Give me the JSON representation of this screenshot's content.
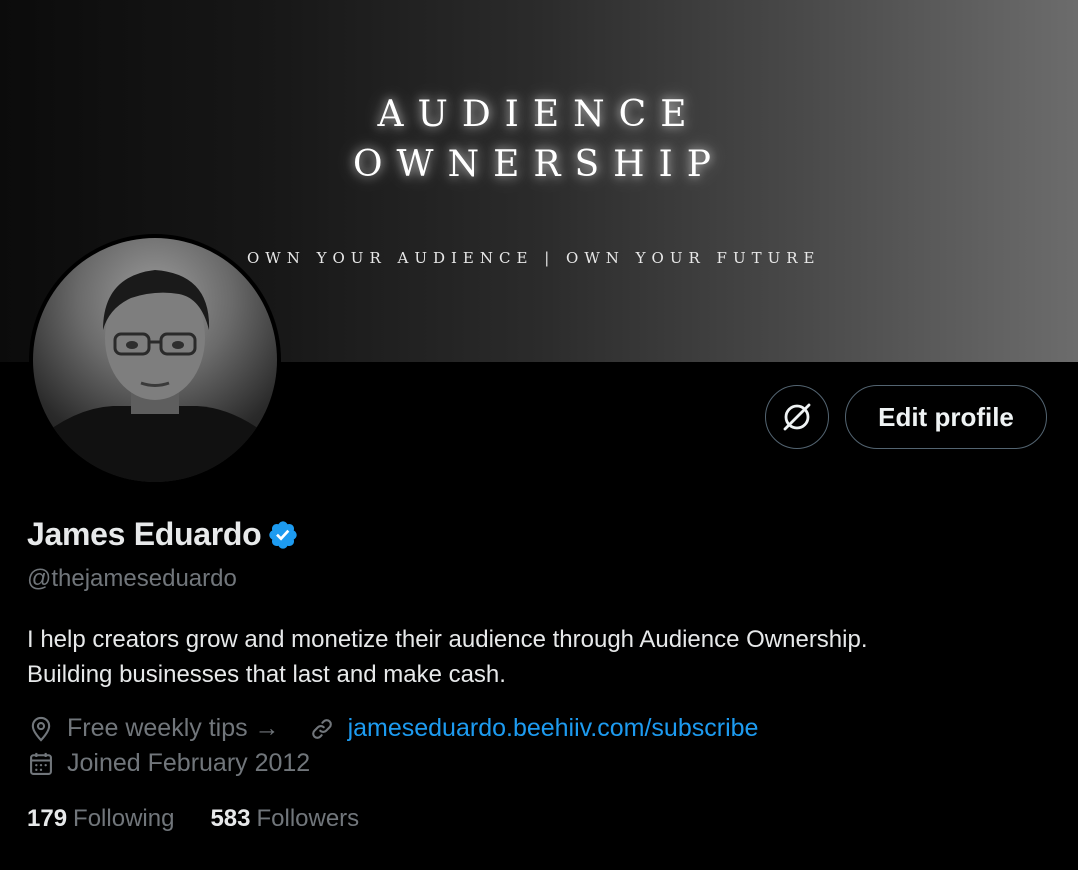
{
  "banner": {
    "title_line1": "AUDIENCE",
    "title_line2": "OWNERSHIP",
    "tagline": "OWN YOUR AUDIENCE | OWN YOUR FUTURE"
  },
  "actions": {
    "edit_profile_label": "Edit profile",
    "icon_button": "grok-icon"
  },
  "profile": {
    "name": "James Eduardo",
    "verified": true,
    "handle": "@thejameseduardo",
    "bio_line1": "I help creators grow and monetize their audience through Audience Ownership.",
    "bio_line2": "Building businesses that last and make cash.",
    "location": "Free weekly tips →",
    "website": "jameseduardo.beehiiv.com/subscribe",
    "joined": "Joined February 2012"
  },
  "stats": {
    "following_count": "179",
    "following_label": "Following",
    "followers_count": "583",
    "followers_label": "Followers"
  },
  "colors": {
    "background": "#000000",
    "accent": "#1d9bf0",
    "secondary_text": "#71767b",
    "primary_text": "#e7e9ea"
  }
}
